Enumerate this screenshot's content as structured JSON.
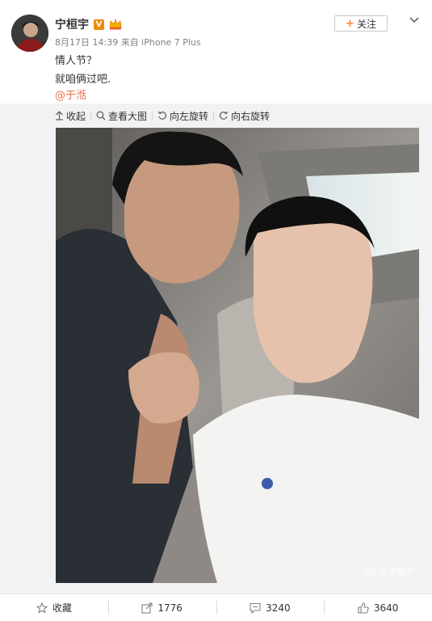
{
  "user": {
    "name": "宁桓宇",
    "verified_badge": "V",
    "meta": "8月17日 14:39 来自 iPhone 7 Plus"
  },
  "post": {
    "line1": "情人节？",
    "line2": "就咱俩过吧.",
    "mention": "@于湉"
  },
  "follow": {
    "plus": "+",
    "label": "关注"
  },
  "toolbar": {
    "collapse": "收起",
    "view_large": "查看大图",
    "rotate_left": "向左旋转",
    "rotate_right": "向右旋转"
  },
  "photo": {
    "watermark": "@宁桓宇"
  },
  "actions": {
    "favorite": "收藏",
    "repost": "1776",
    "comment": "3240",
    "like": "3640"
  },
  "colors": {
    "accent": "#eb7350",
    "follow_plus": "#ff8140",
    "badge": "#f08b08",
    "meta_gray": "#808080"
  }
}
